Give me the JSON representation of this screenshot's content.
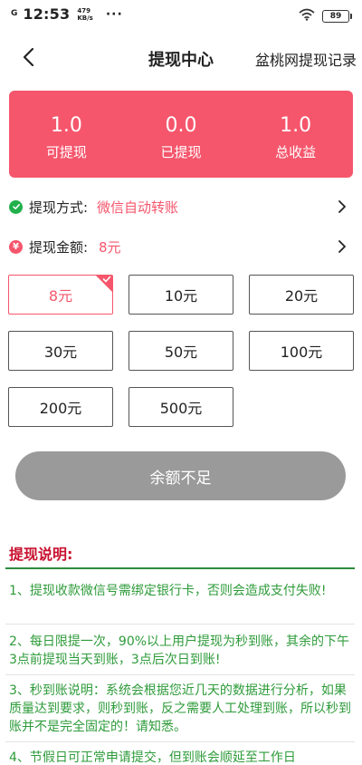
{
  "status_bar": {
    "signal": "G",
    "time": "12:53",
    "speed_value": "479",
    "speed_unit": "KB/s",
    "more": "···",
    "battery": "89"
  },
  "header": {
    "title": "提现中心",
    "records_link": "盆桃网提现记录"
  },
  "balance": {
    "available": {
      "value": "1.0",
      "label": "可提现"
    },
    "withdrawn": {
      "value": "0.0",
      "label": "已提现"
    },
    "total": {
      "value": "1.0",
      "label": "总收益"
    }
  },
  "method_row": {
    "label": "提现方式:",
    "value": "微信自动转账"
  },
  "amount_row": {
    "label": "提现金额:",
    "value": "8元"
  },
  "amounts": [
    "8元",
    "10元",
    "20元",
    "30元",
    "50元",
    "100元",
    "200元",
    "500元"
  ],
  "selected_amount": "8元",
  "submit_label": "余额不足",
  "notes": {
    "title": "提现说明:",
    "items": [
      "1、提现收款微信号需绑定银行卡，否则会造成支付失败!",
      "2、每日限提一次，90%以上用户提现为秒到账，其余的下午3点前提现当天到账，3点后次日到账!",
      "3、秒到账说明：系统会根据您近几天的数据进行分析，如果质量达到要求，则秒到账，反之需要人工处理到账，所以秒到账并不是完全固定的！请知悉。",
      "4、节假日可正常申请提交，但到账会顺延至工作日"
    ]
  },
  "colors": {
    "accent": "#f5566c",
    "notes_text": "#2e9b3a",
    "notes_title": "#c8102e",
    "disabled_button": "#9a9a9a"
  },
  "icons": {
    "back": "chevron-left-icon",
    "wechat": "wechat-check-icon",
    "yen": "yen-icon",
    "arrow": "chevron-right-icon",
    "wifi": "wifi-icon",
    "battery": "battery-icon"
  }
}
